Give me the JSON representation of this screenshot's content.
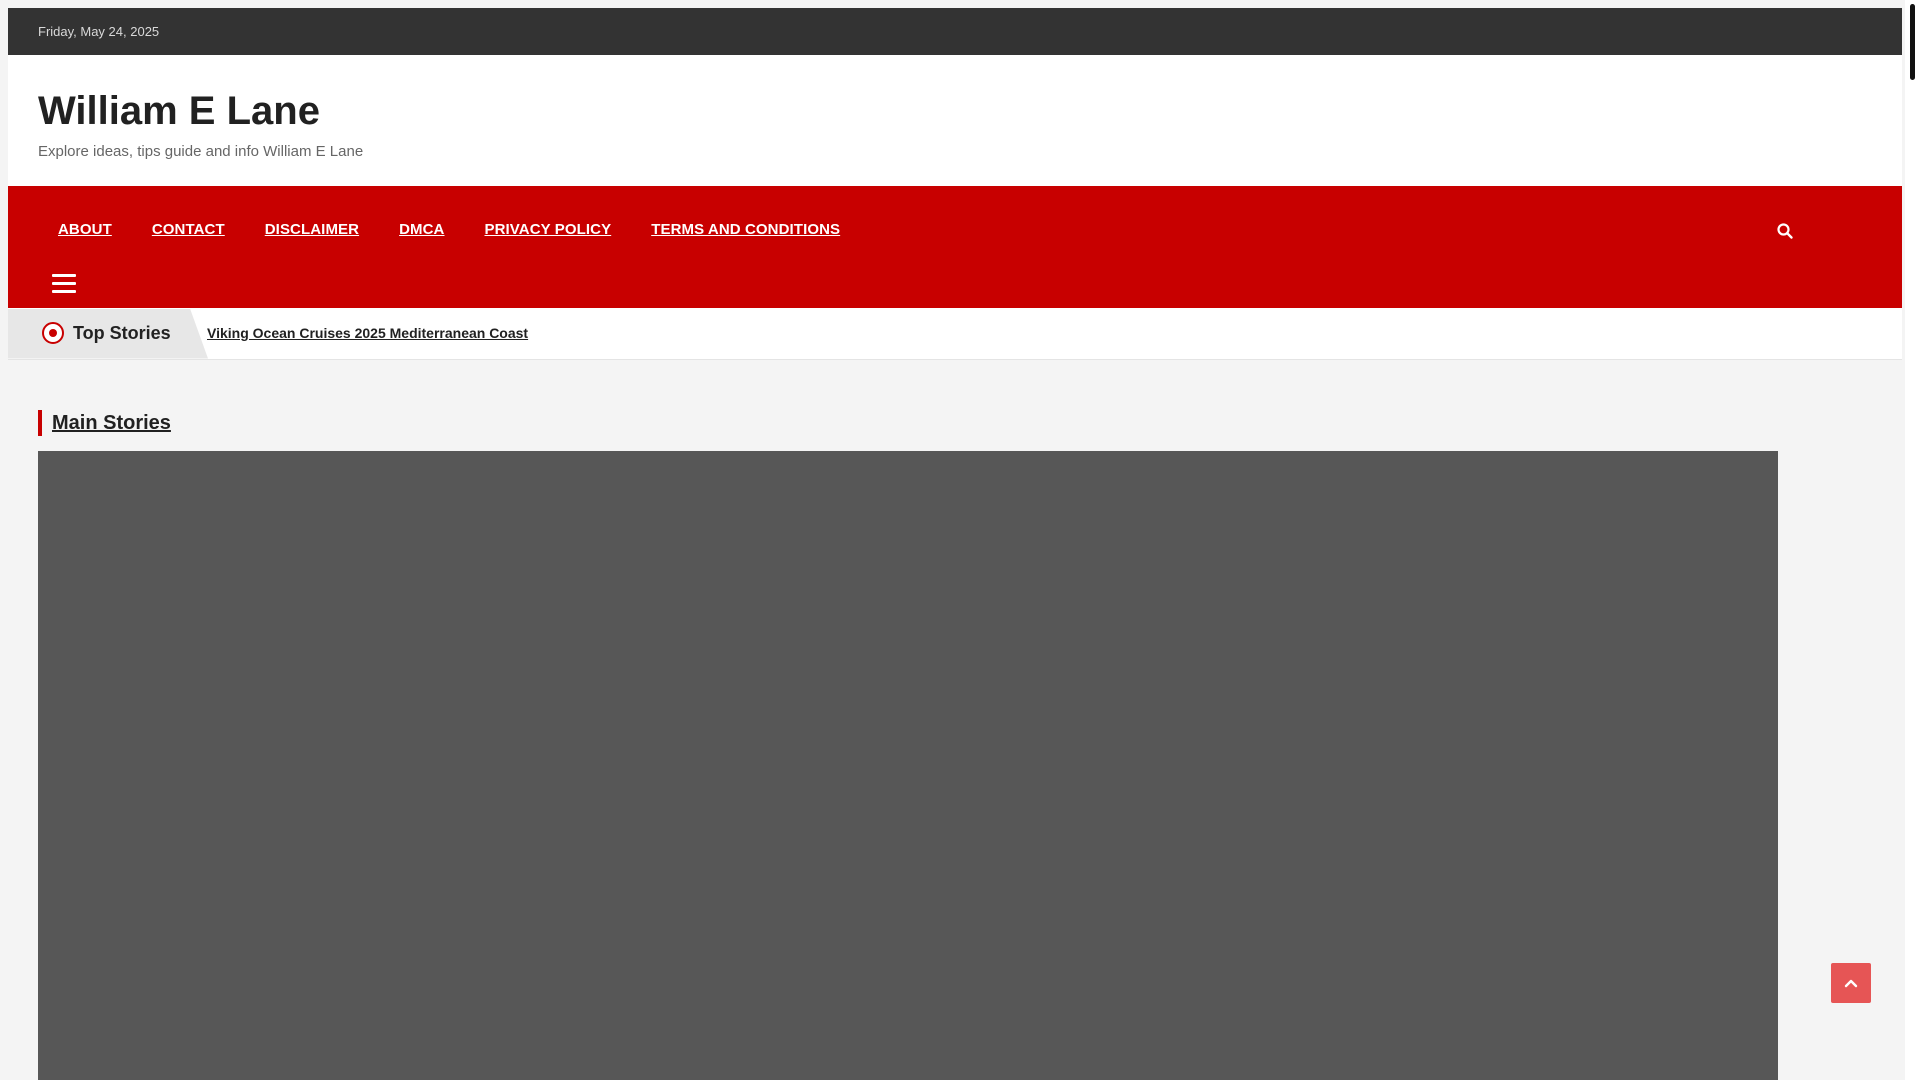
{
  "topbar": {
    "date": "Friday, May 24, 2025"
  },
  "site": {
    "title": "William E Lane",
    "tagline": "Explore ideas, tips guide and info William E Lane"
  },
  "nav": {
    "items": [
      {
        "label": "ABOUT"
      },
      {
        "label": "CONTACT"
      },
      {
        "label": "DISCLAIMER"
      },
      {
        "label": "DMCA"
      },
      {
        "label": "PRIVACY POLICY"
      },
      {
        "label": "TERMS AND CONDITIONS"
      }
    ],
    "search_icon": "search-icon",
    "menu_icon": "hamburger-menu-icon"
  },
  "ticker": {
    "label": "Top Stories",
    "item": "Viking Ocean Cruises 2025 Mediterranean Coast"
  },
  "main": {
    "heading": "Main Stories"
  },
  "colors": {
    "topbar": "#333333",
    "nav": "#c80000",
    "accent": "#c80000",
    "featured_placeholder": "#575757",
    "back_to_top": "#e65555"
  }
}
